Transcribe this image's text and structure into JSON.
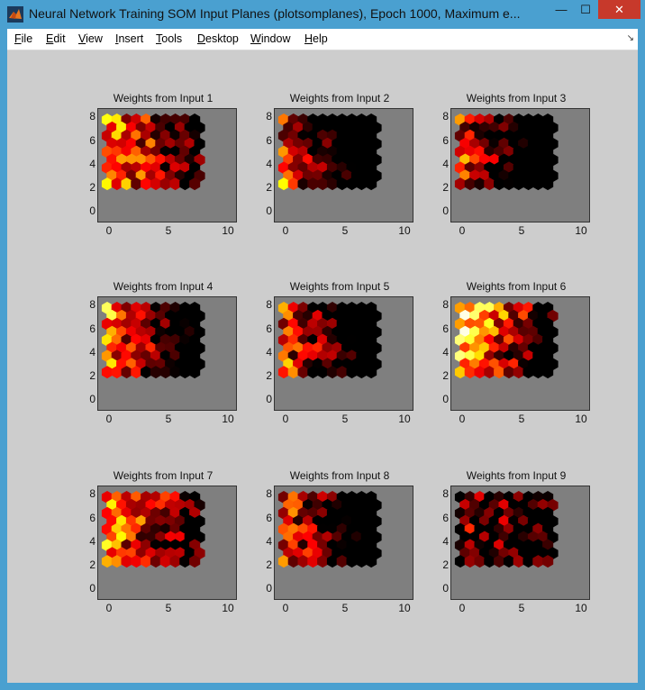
{
  "window": {
    "title": "Neural Network Training SOM Input Planes (plotsomplanes), Epoch 1000, Maximum e...",
    "minimize_label": "—",
    "maximize_label": "☐",
    "close_label": "✕"
  },
  "menu": {
    "file": {
      "u": "F",
      "rest": "ile"
    },
    "edit": {
      "u": "E",
      "rest": "dit"
    },
    "view": {
      "u": "V",
      "rest": "iew"
    },
    "insert": {
      "u": "I",
      "rest": "nsert"
    },
    "tools": {
      "u": "T",
      "rest": "ools"
    },
    "desktop": {
      "u": "D",
      "rest": "esktop"
    },
    "window": {
      "u": "W",
      "rest": "indow"
    },
    "help": {
      "u": "H",
      "rest": "elp"
    }
  },
  "figure": {
    "background": "#cdcdcd",
    "axes_color": "#7f7f7f",
    "colormap": "hot",
    "y_ticks": [
      "8",
      "6",
      "4",
      "2",
      "0"
    ],
    "x_ticks": [
      "0",
      "5",
      "10"
    ],
    "panels": [
      {
        "title": "Weights from Input 1"
      },
      {
        "title": "Weights from Input 2"
      },
      {
        "title": "Weights from Input 3"
      },
      {
        "title": "Weights from Input 4"
      },
      {
        "title": "Weights from Input 5"
      },
      {
        "title": "Weights from Input 6"
      },
      {
        "title": "Weights from Input 7"
      },
      {
        "title": "Weights from Input 8"
      },
      {
        "title": "Weights from Input 9"
      }
    ]
  }
}
